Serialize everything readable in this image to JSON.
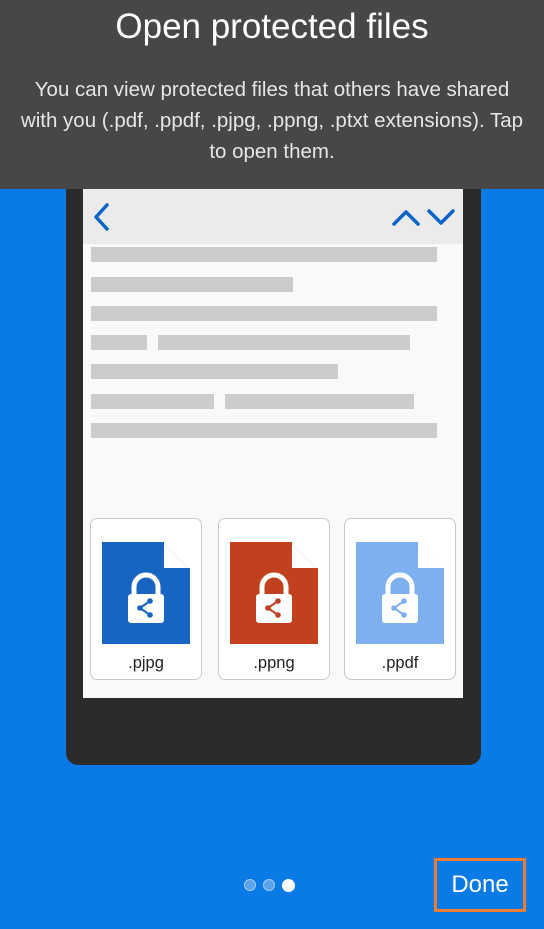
{
  "header": {
    "title": "Open protected files",
    "description": "You can view protected files that others have shared with you (.pdf, .ppdf, .pjpg, .ppng, .ptxt extensions). Tap to open them."
  },
  "files": [
    {
      "extension": ".pjpg",
      "color": "#1864c3"
    },
    {
      "extension": ".ppng",
      "color": "#c1401e"
    },
    {
      "extension": ".ppdf",
      "color": "#7eaff0"
    }
  ],
  "pager": {
    "pages": 3,
    "current": 3
  },
  "done_label": "Done",
  "colors": {
    "background": "#0a7be6",
    "header": "#474747",
    "device": "#2b2b2b",
    "accent": "#0a64c8",
    "highlight": "#ef7d31"
  }
}
